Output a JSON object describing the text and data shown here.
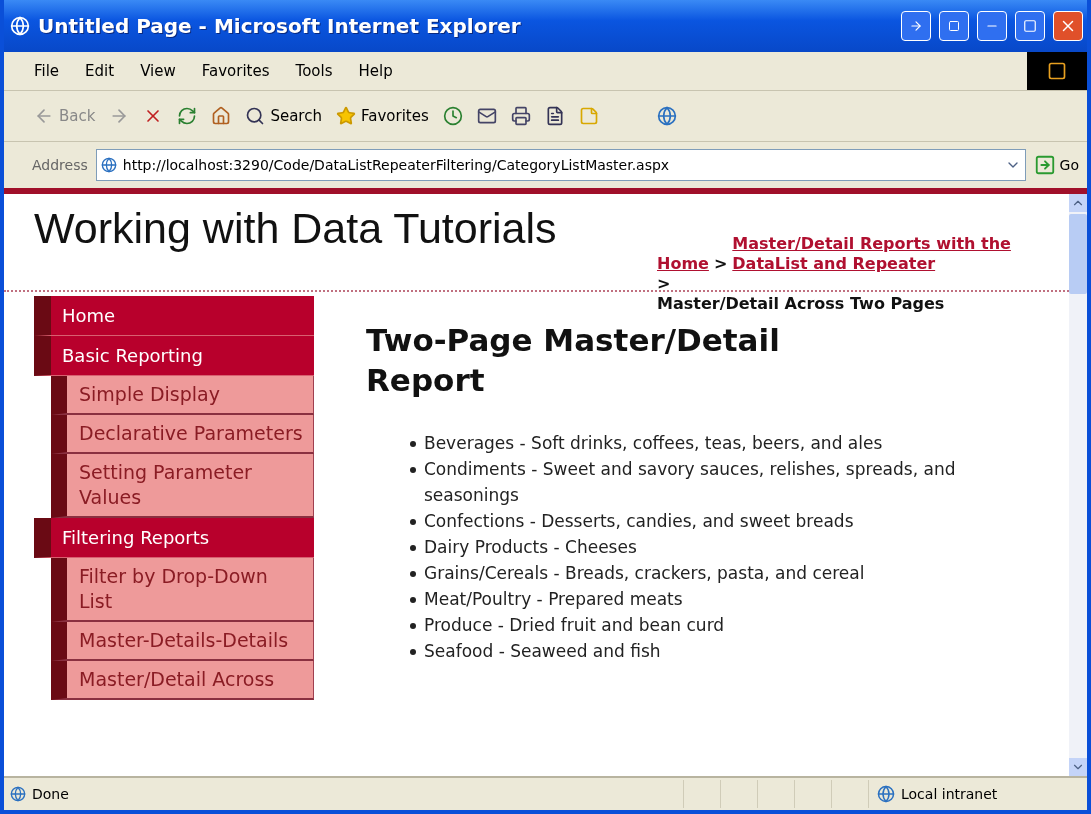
{
  "window": {
    "title": "Untitled Page - Microsoft Internet Explorer"
  },
  "menu": [
    "File",
    "Edit",
    "View",
    "Favorites",
    "Tools",
    "Help"
  ],
  "toolbar": [
    {
      "kind": "back",
      "label": "Back"
    },
    {
      "kind": "search",
      "label": "Search"
    },
    {
      "kind": "favorites",
      "label": "Favorites"
    }
  ],
  "address": {
    "label": "Address",
    "url": "http://localhost:3290/Code/DataListRepeaterFiltering/CategoryListMaster.aspx",
    "go": "Go"
  },
  "page": {
    "site_title": "Working with Data Tutorials",
    "breadcrumb": [
      {
        "kind": "link",
        "text": "Home"
      },
      {
        "kind": "separator",
        "text": ">"
      },
      {
        "kind": "link",
        "text": "Master/Detail Reports with the DataList and Repeater"
      },
      {
        "kind": "separator",
        "text": ">"
      },
      {
        "kind": "current",
        "text": "Master/Detail Across Two Pages"
      }
    ],
    "sidebar": [
      {
        "label": "Home"
      },
      {
        "label": "Basic Reporting",
        "children": [
          {
            "label": "Simple Display"
          },
          {
            "label": "Declarative Parameters"
          },
          {
            "label": "Setting Parameter Values"
          }
        ]
      },
      {
        "label": "Filtering Reports",
        "children": [
          {
            "label": "Filter by Drop-Down List"
          },
          {
            "label": "Master-Details-Details"
          },
          {
            "label": "Master/Detail Across"
          }
        ]
      }
    ],
    "heading": "Two-Page Master/Detail Report",
    "categories": [
      "Beverages - Soft drinks, coffees, teas, beers, and ales",
      "Condiments - Sweet and savory sauces, relishes, spreads, and seasonings",
      "Confections - Desserts, candies, and sweet breads",
      "Dairy Products - Cheeses",
      "Grains/Cereals - Breads, crackers, pasta, and cereal",
      "Meat/Poultry - Prepared meats",
      "Produce - Dried fruit and bean curd",
      "Seafood - Seaweed and fish"
    ]
  },
  "status_bar": {
    "text": "Done",
    "zone": "Local intranet"
  }
}
